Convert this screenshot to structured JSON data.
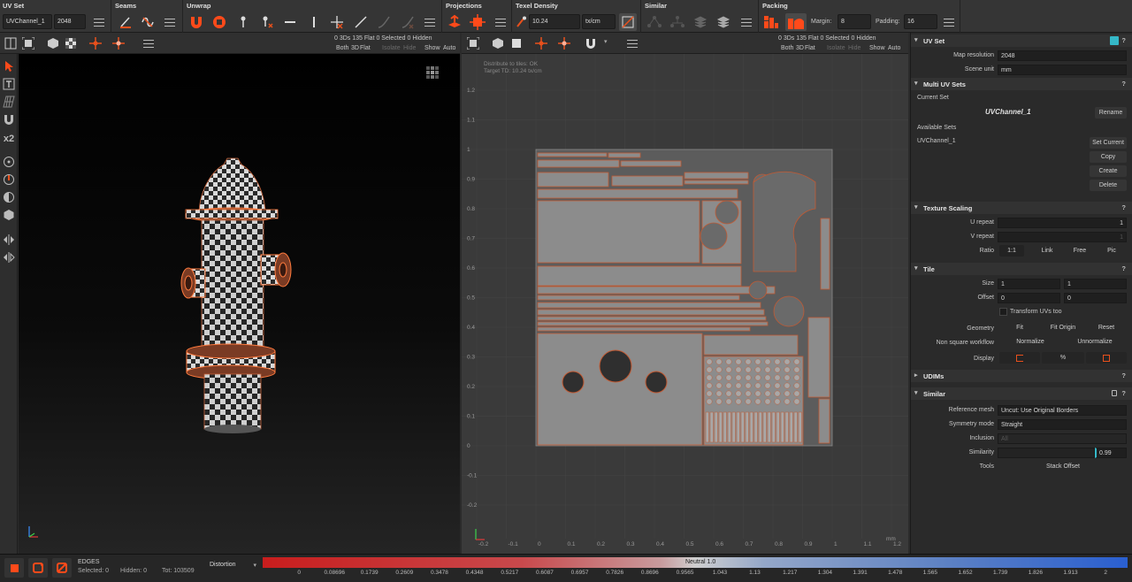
{
  "toolbar": {
    "sections": {
      "uvset": "UV Set",
      "seams": "Seams",
      "unwrap": "Unwrap",
      "projections": "Projections",
      "texel": "Texel Density",
      "similar": "Similar",
      "packing": "Packing"
    },
    "uvset_value": "UVChannel_1",
    "uvset_res": "2048",
    "texel_value": "10.24",
    "texel_unit": "tx/cm",
    "margin_label": "Margin:",
    "margin_value": "8",
    "padding_label": "Padding:",
    "padding_value": "16"
  },
  "viewport3d": {
    "stats_line1": "0 3Ds 135 Flat  0 Selected   0 Hidden",
    "stats_both": "Both",
    "stats_3d": "3D",
    "stats_flat": "Flat",
    "stats_isolate": "Isolate",
    "stats_hide": "Hide",
    "stats_show": "Show",
    "stats_auto": "Auto"
  },
  "viewportuv": {
    "stats_line1": "0 3Ds 135 Flat  0 Selected   0 Hidden",
    "stats_both": "Both",
    "stats_3d": "3D",
    "stats_flat": "Flat",
    "stats_isolate": "Isolate",
    "stats_hide": "Hide",
    "stats_show": "Show",
    "stats_auto": "Auto",
    "info1": "Distribute to tiles: OK",
    "info2": "Target TD: 10.24 tx/cm",
    "y_ticks": [
      "1.2",
      "1.1",
      "1",
      "0.9",
      "0.8",
      "0.7",
      "0.6",
      "0.5",
      "0.4",
      "0.3",
      "0.2",
      "0.1",
      "0",
      "-0.1",
      "-0.2"
    ],
    "x_ticks": [
      "-0.2",
      "-0.1",
      "0",
      "0.1",
      "0.2",
      "0.3",
      "0.4",
      "0.5",
      "0.6",
      "0.7",
      "0.8",
      "0.9",
      "1",
      "1.1",
      "1.2"
    ],
    "unit": "mm"
  },
  "panel": {
    "uvset": {
      "title": "UV Set",
      "map_res_label": "Map resolution",
      "map_res_value": "2048",
      "scene_unit_label": "Scene unit",
      "scene_unit_value": "mm"
    },
    "multi": {
      "title": "Multi UV Sets",
      "current_label": "Current Set",
      "current_value": "UVChannel_1",
      "rename": "Rename",
      "available_label": "Available Sets",
      "available_item": "UVChannel_1",
      "set_current": "Set Current",
      "copy": "Copy",
      "create": "Create",
      "delete": "Delete"
    },
    "texscale": {
      "title": "Texture Scaling",
      "u_label": "U repeat",
      "u_value": "1",
      "v_label": "V repeat",
      "v_value": "1",
      "ratio_label": "Ratio",
      "ratio_value": "1:1",
      "link": "Link",
      "free": "Free",
      "pic": "Pic"
    },
    "tile": {
      "title": "Tile",
      "size_label": "Size",
      "size_u": "1",
      "size_v": "1",
      "offset_label": "Offset",
      "offset_u": "0",
      "offset_v": "0",
      "transform_label": "Transform UVs too",
      "geometry_label": "Geometry",
      "fit": "Fit",
      "fit_origin": "Fit Origin",
      "reset": "Reset",
      "nonsquare_label": "Non square workflow",
      "normalize": "Normalize",
      "unnormalize": "Unnormalize",
      "display_label": "Display",
      "display_pct": "%"
    },
    "udims": {
      "title": "UDIMs"
    },
    "similar": {
      "title": "Similar",
      "ref_label": "Reference mesh",
      "ref_value": "Uncut: Use Original Borders",
      "sym_label": "Symmetry mode",
      "sym_value": "Straight",
      "incl_label": "Inclusion",
      "incl_value": "All",
      "sim_label": "Similarity",
      "sim_value": "0.99",
      "tools_label": "Tools",
      "stack_offset": "Stack Offset"
    }
  },
  "bottom": {
    "mode": "EDGES",
    "selected": "Selected: 0",
    "hidden": "Hidden: 0",
    "total": "Tot: 103509",
    "dropdown": "Distortion",
    "neutral": "Neutral 1.0",
    "ticks": [
      "0",
      "0.08696",
      "0.1739",
      "0.2609",
      "0.3478",
      "0.4348",
      "0.5217",
      "0.6087",
      "0.6957",
      "0.7826",
      "0.8696",
      "0.9565",
      "1.043",
      "1.13",
      "1.217",
      "1.304",
      "1.391",
      "1.478",
      "1.565",
      "1.652",
      "1.739",
      "1.826",
      "1.913",
      "2"
    ]
  },
  "colors": {
    "accent": "#e8501c",
    "accent_bright": "#ff5a1f",
    "panel_bg": "#2a2a2a",
    "uv_bg": "#3a3a3a"
  }
}
